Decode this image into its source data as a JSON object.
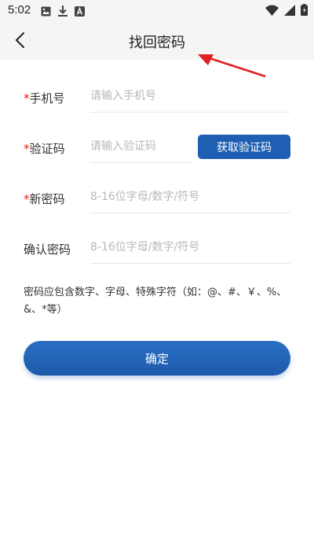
{
  "status_bar": {
    "time": "5:02",
    "left_icons": [
      "image-icon",
      "download-icon",
      "app-a-icon"
    ],
    "right_icons": [
      "wifi-icon",
      "signal-icon",
      "battery-icon"
    ]
  },
  "nav": {
    "title": "找回密码",
    "back_icon": "chevron-left-icon"
  },
  "form": {
    "phone": {
      "required_mark": "*",
      "label": "手机号",
      "placeholder": "请输入手机号"
    },
    "code": {
      "required_mark": "*",
      "label": "验证码",
      "placeholder": "请输入验证码",
      "button_label": "获取验证码"
    },
    "new_password": {
      "required_mark": "*",
      "label": "新密码",
      "placeholder": "8-16位字母/数字/符号"
    },
    "confirm_password": {
      "label": "确认密码",
      "placeholder": "8-16位字母/数字/符号"
    }
  },
  "hint": "密码应包含数字、字母、特殊字符（如：@、#、￥、%、&、*等）",
  "confirm_button": "确定",
  "colors": {
    "primary": "#1f5fb3",
    "required": "#e2231a",
    "annotation": "#e02020",
    "header_bg": "#f5f5f5"
  }
}
